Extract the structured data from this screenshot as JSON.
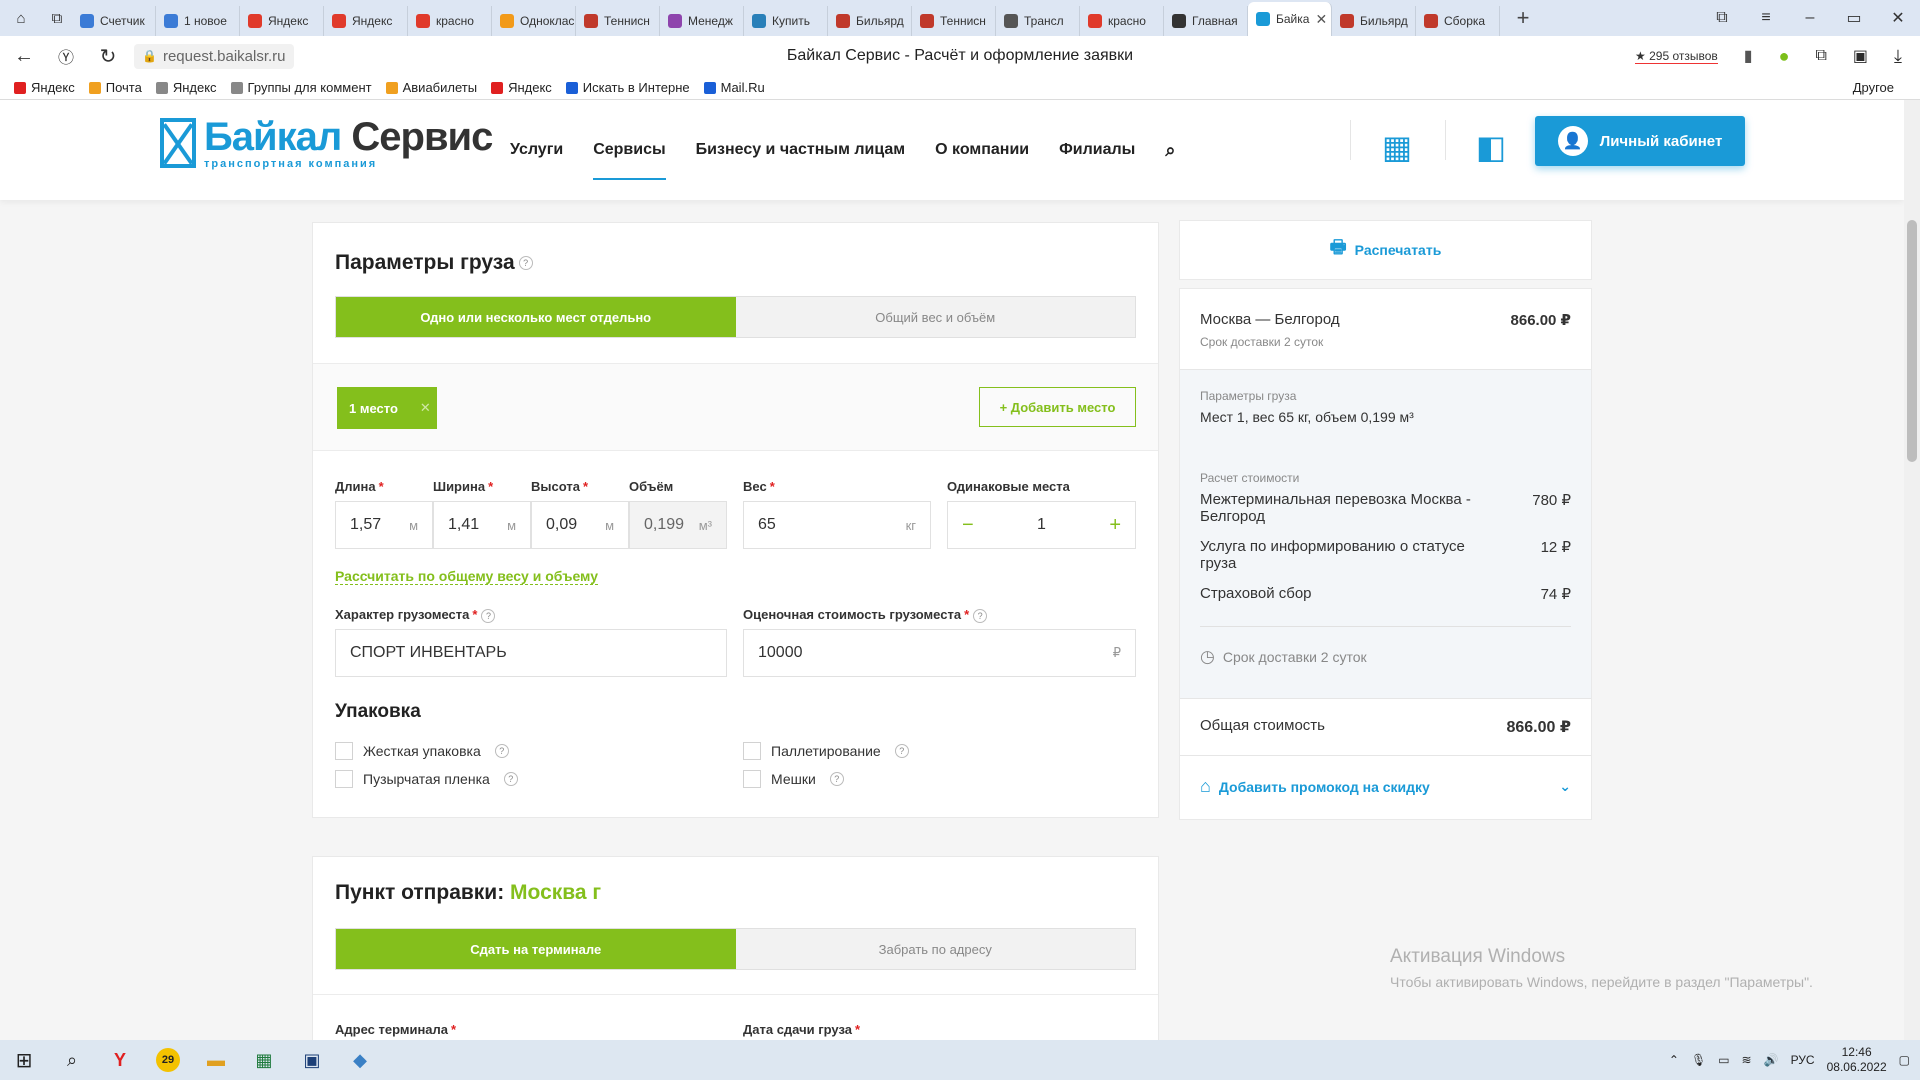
{
  "browser": {
    "tabs": [
      {
        "label": "Счетчик",
        "color": "#3b7bd6"
      },
      {
        "label": "1 новое",
        "color": "#3b7bd6"
      },
      {
        "label": "Яндекс",
        "color": "#e03a2b"
      },
      {
        "label": "Яндекс",
        "color": "#e03a2b"
      },
      {
        "label": "красно",
        "color": "#e03a2b"
      },
      {
        "label": "Одноклас",
        "color": "#f29a19"
      },
      {
        "label": "Теннисн",
        "color": "#c0392b"
      },
      {
        "label": "Менедж",
        "color": "#8e44ad"
      },
      {
        "label": "Купить",
        "color": "#2980b9"
      },
      {
        "label": "Бильярд",
        "color": "#c0392b"
      },
      {
        "label": "Теннисн",
        "color": "#c0392b"
      },
      {
        "label": "Трансл",
        "color": "#555"
      },
      {
        "label": "красно",
        "color": "#e03a2b"
      },
      {
        "label": "Главная",
        "color": "#333"
      },
      {
        "label": "Байка",
        "color": "#1a9ad7",
        "active": true
      },
      {
        "label": "Бильярд",
        "color": "#c0392b"
      },
      {
        "label": "Сборка",
        "color": "#c0392b"
      }
    ],
    "url": "request.baikalsr.ru",
    "page_title": "Байкал Сервис - Расчёт и оформление заявки",
    "reviews": "★ 295 отзывов",
    "bookmarks": [
      "Яндекс",
      "Почта",
      "Яндекс",
      "Группы для коммент",
      "Авиабилеты",
      "Яндекс",
      "Искать в Интерне",
      "Mail.Ru"
    ],
    "bookmarks_other": "Другое"
  },
  "site": {
    "logo_name_a": "Байкал",
    "logo_name_b": "Сервис",
    "logo_sub": "транспортная компания",
    "nav": [
      "Услуги",
      "Сервисы",
      "Бизнесу и частным лицам",
      "О компании",
      "Филиалы"
    ],
    "cabinet": "Личный кабинет"
  },
  "cargo": {
    "title": "Параметры груза",
    "mode_on": "Одно или несколько мест отдельно",
    "mode_off": "Общий вес и объём",
    "place_tag": "1 место",
    "add_place": "+ Добавить место",
    "fields": {
      "length_label": "Длина",
      "length": "1,57",
      "length_unit": "м",
      "width_label": "Ширина",
      "width": "1,41",
      "width_unit": "м",
      "height_label": "Высота",
      "height": "0,09",
      "height_unit": "м",
      "volume_label": "Объём",
      "volume": "0,199",
      "volume_unit": "м³",
      "weight_label": "Вес",
      "weight": "65",
      "weight_unit": "кг",
      "same_label": "Одинаковые места",
      "same": "1"
    },
    "calc_link": "Рассчитать по общему весу и объему",
    "nature_label": "Характер грузоместа",
    "nature": "СПОРТ ИНВЕНТАРЬ",
    "price_label": "Оценочная стоимость грузоместа",
    "price": "10000",
    "currency": "₽",
    "pack_title": "Упаковка",
    "pack": [
      "Жесткая упаковка",
      "Паллетирование",
      "Пузырчатая пленка",
      "Мешки"
    ]
  },
  "dispatch": {
    "title": "Пункт отправки:",
    "city": "Москва г",
    "mode_on": "Сдать на терминале",
    "mode_off": "Забрать по адресу",
    "addr_label": "Адрес терминала",
    "date_label": "Дата сдачи груза"
  },
  "summary": {
    "print": "Распечатать",
    "route": "Москва — Белгород",
    "route_price": "866.00 ₽",
    "route_term": "Срок доставки 2 суток",
    "params_caption": "Параметры груза",
    "params": "Мест 1, вес 65 кг, объем 0,199 м³",
    "calc_caption": "Расчет стоимости",
    "items": [
      {
        "name": "Межтерминальная перевозка Москва - Белгород",
        "price": "780 ₽"
      },
      {
        "name": "Услуга по информированию о статусе груза",
        "price": "12 ₽"
      },
      {
        "name": "Страховой сбор",
        "price": "74 ₽"
      }
    ],
    "term": "Срок доставки 2 суток",
    "total_label": "Общая стоимость",
    "total": "866.00 ₽",
    "promo": "Добавить промокод на скидку"
  },
  "windows": {
    "wm_title": "Активация Windows",
    "wm_sub": "Чтобы активировать Windows, перейдите в раздел \"Параметры\".",
    "badge": "29",
    "lang": "РУС",
    "time": "12:46",
    "date": "08.06.2022"
  },
  "colors": {
    "brand": "#1a9ad7",
    "accent": "#84bf1c"
  }
}
